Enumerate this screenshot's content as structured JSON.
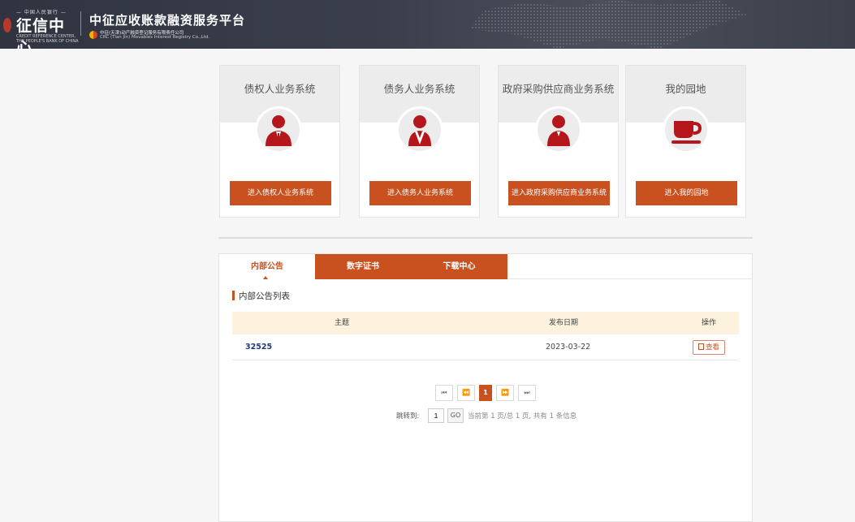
{
  "header": {
    "logo_small": "— 中国人民银行 —",
    "logo_main": "征信中心",
    "logo_en": "CREDIT REFERENCE CENTER, THE PEOPLE'S BANK OF CHINA",
    "platform_title": "中征应收账款融资服务平台",
    "crc_cn": "中征(天津)动产融资登记服务有限责任公司",
    "crc_en": "CRC (Tian Jin) Movables Interest Registry Co.,Ltd."
  },
  "cards": [
    {
      "title": "债权人业务系统",
      "button": "进入债权人业务系统",
      "icon": "creditor-person-icon"
    },
    {
      "title": "债务人业务系统",
      "button": "进入债务人业务系统",
      "icon": "debtor-person-icon"
    },
    {
      "title": "政府采购供应商业务系统",
      "button": "进入政府采购供应商业务系统",
      "icon": "supplier-person-icon"
    },
    {
      "title": "我的园地",
      "button": "进入我的园地",
      "icon": "coffee-cup-icon"
    }
  ],
  "tabs": [
    {
      "label": "内部公告",
      "active": true
    },
    {
      "label": "数字证书",
      "active": false
    },
    {
      "label": "下载中心",
      "active": false
    }
  ],
  "list": {
    "heading": "内部公告列表",
    "columns": {
      "subject": "主题",
      "date": "发布日期",
      "action": "操作"
    },
    "rows": [
      {
        "subject": "32525",
        "date": "2023-03-22",
        "action": "查看"
      }
    ]
  },
  "pagination": {
    "first": "⏮",
    "prev": "⏪",
    "current": "1",
    "next": "⏩",
    "last": "⏭",
    "jump_label": "跳转到:",
    "jump_value": "1",
    "go": "GO",
    "info": "当前第 1 页/总 1 页, 共有 1 条信息"
  },
  "colors": {
    "accent": "#c9511f",
    "header_bg": "#3a3f4b",
    "icon_red": "#b5161b"
  }
}
